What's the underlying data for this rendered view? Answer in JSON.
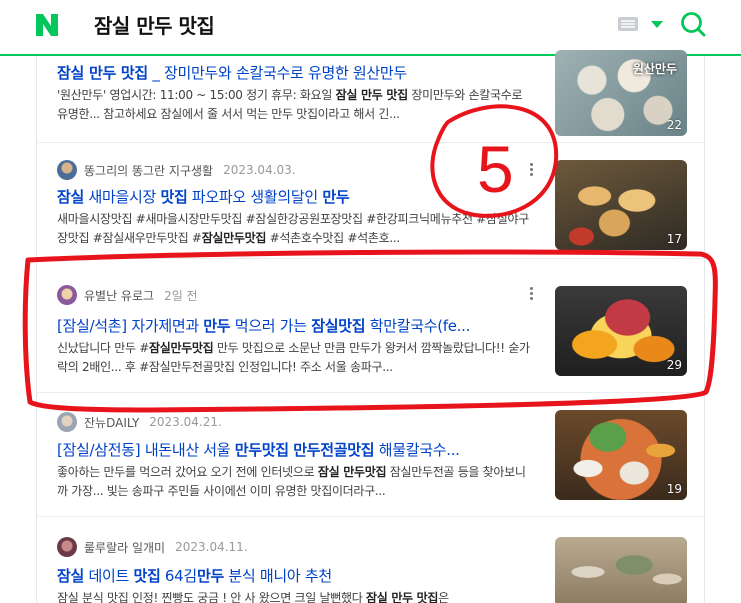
{
  "header": {
    "logo_letter": "N",
    "query": "잠실 만두 맛집"
  },
  "colors": {
    "brand": "#03c75a",
    "link": "#0043c8",
    "annotation": "#e8141b"
  },
  "annotation": {
    "label": "5"
  },
  "results": [
    {
      "title_parts": [
        {
          "text": "잠실 ",
          "bold": true
        },
        {
          "text": "만두 ",
          "bold": true
        },
        {
          "text": "맛집",
          "bold": true
        },
        {
          "text": " _ 장미만두와 손칼국수로 유명한 원산만두",
          "bold": false
        }
      ],
      "desc_parts": [
        {
          "text": "'원산만두' 영업시간: 11:00 ~ 15:00 정기 휴무: 화요일 ",
          "bold": false
        },
        {
          "text": "잠실 만두 맛집",
          "bold": true
        },
        {
          "text": " 장미만두와 손칼국수로 유명한... 참고하세요 잠실에서 줄 서서 먹는 만두 맛집이라고 해서 긴...",
          "bold": false
        }
      ],
      "thumb_overlay": "원산만두",
      "thumb_count": "22"
    },
    {
      "source": "똥그리의 똥그란 지구생활",
      "date": "2023.04.03.",
      "title_parts": [
        {
          "text": "잠실",
          "bold": true
        },
        {
          "text": " 새마을시장 ",
          "bold": false
        },
        {
          "text": "맛집",
          "bold": true
        },
        {
          "text": " 파오파오 생활의달인 ",
          "bold": false
        },
        {
          "text": "만두",
          "bold": true
        }
      ],
      "desc_parts": [
        {
          "text": "새마을시장맛집 #새마을시장만두맛집 #잠실한강공원포장맛집 #한강피크닉메뉴추천 #잠실야구장맛집 #잠실새우만두맛집 #",
          "bold": false
        },
        {
          "text": "잠실만두맛집",
          "bold": true
        },
        {
          "text": " #석촌호수맛집 #석촌호...",
          "bold": false
        }
      ],
      "thumb_count": "17"
    },
    {
      "source": "유별난 유로그",
      "date": "2일 전",
      "title_parts": [
        {
          "text": "[잠실/석촌] 자가제면과 ",
          "bold": false
        },
        {
          "text": "만두",
          "bold": true
        },
        {
          "text": " 먹으러 가는 ",
          "bold": false
        },
        {
          "text": "잠실맛집",
          "bold": true
        },
        {
          "text": " 학만칼국수(fe...",
          "bold": false
        }
      ],
      "desc_parts": [
        {
          "text": "신났답니다 만두 #",
          "bold": false
        },
        {
          "text": "잠실만두맛집",
          "bold": true
        },
        {
          "text": " 만두 맛집으로 소문난 만큼 만두가 왕커서 깜짝놀랐답니다!! 숟가락의 2배인... 후 #잠실만두전골맛집 인정입니다! 주소 서울 송파구...",
          "bold": false
        }
      ],
      "thumb_count": "29"
    },
    {
      "source": "잔뉴DAILY",
      "date": "2023.04.21.",
      "title_parts": [
        {
          "text": "[잠실/삼전동] 내돈내산 서울 ",
          "bold": false
        },
        {
          "text": "만두맛집",
          "bold": true
        },
        {
          "text": " ",
          "bold": false
        },
        {
          "text": "만두전골맛집",
          "bold": true
        },
        {
          "text": " 해물칼국수...",
          "bold": false
        }
      ],
      "desc_parts": [
        {
          "text": "좋아하는 만두를 먹으러 갔어요 오기 전에 인터넷으로 ",
          "bold": false
        },
        {
          "text": "잠실 만두맛집",
          "bold": true
        },
        {
          "text": " 잠실만두전골 등을 찾아보니까 가장... 빛는 송파구 주민들 사이에선 이미 유명한 맛집이더라구...",
          "bold": false
        }
      ],
      "thumb_count": "19"
    },
    {
      "source": "룰루랄라 일개미",
      "date": "2023.04.11.",
      "title_parts": [
        {
          "text": "잠실",
          "bold": true
        },
        {
          "text": " 데이트 ",
          "bold": false
        },
        {
          "text": "맛집",
          "bold": true
        },
        {
          "text": " 64김",
          "bold": false
        },
        {
          "text": "만두",
          "bold": true
        },
        {
          "text": " 분식 매니아 추천",
          "bold": false
        }
      ],
      "desc_parts": [
        {
          "text": "잠실 분식 맛집 인정! 찐빵도 궁금 ! 안 사 왔으면 크일 날뻔했다 ",
          "bold": false
        },
        {
          "text": "잠실 만두 맛집",
          "bold": true
        },
        {
          "text": "은",
          "bold": false
        }
      ],
      "thumb_count": ""
    }
  ]
}
